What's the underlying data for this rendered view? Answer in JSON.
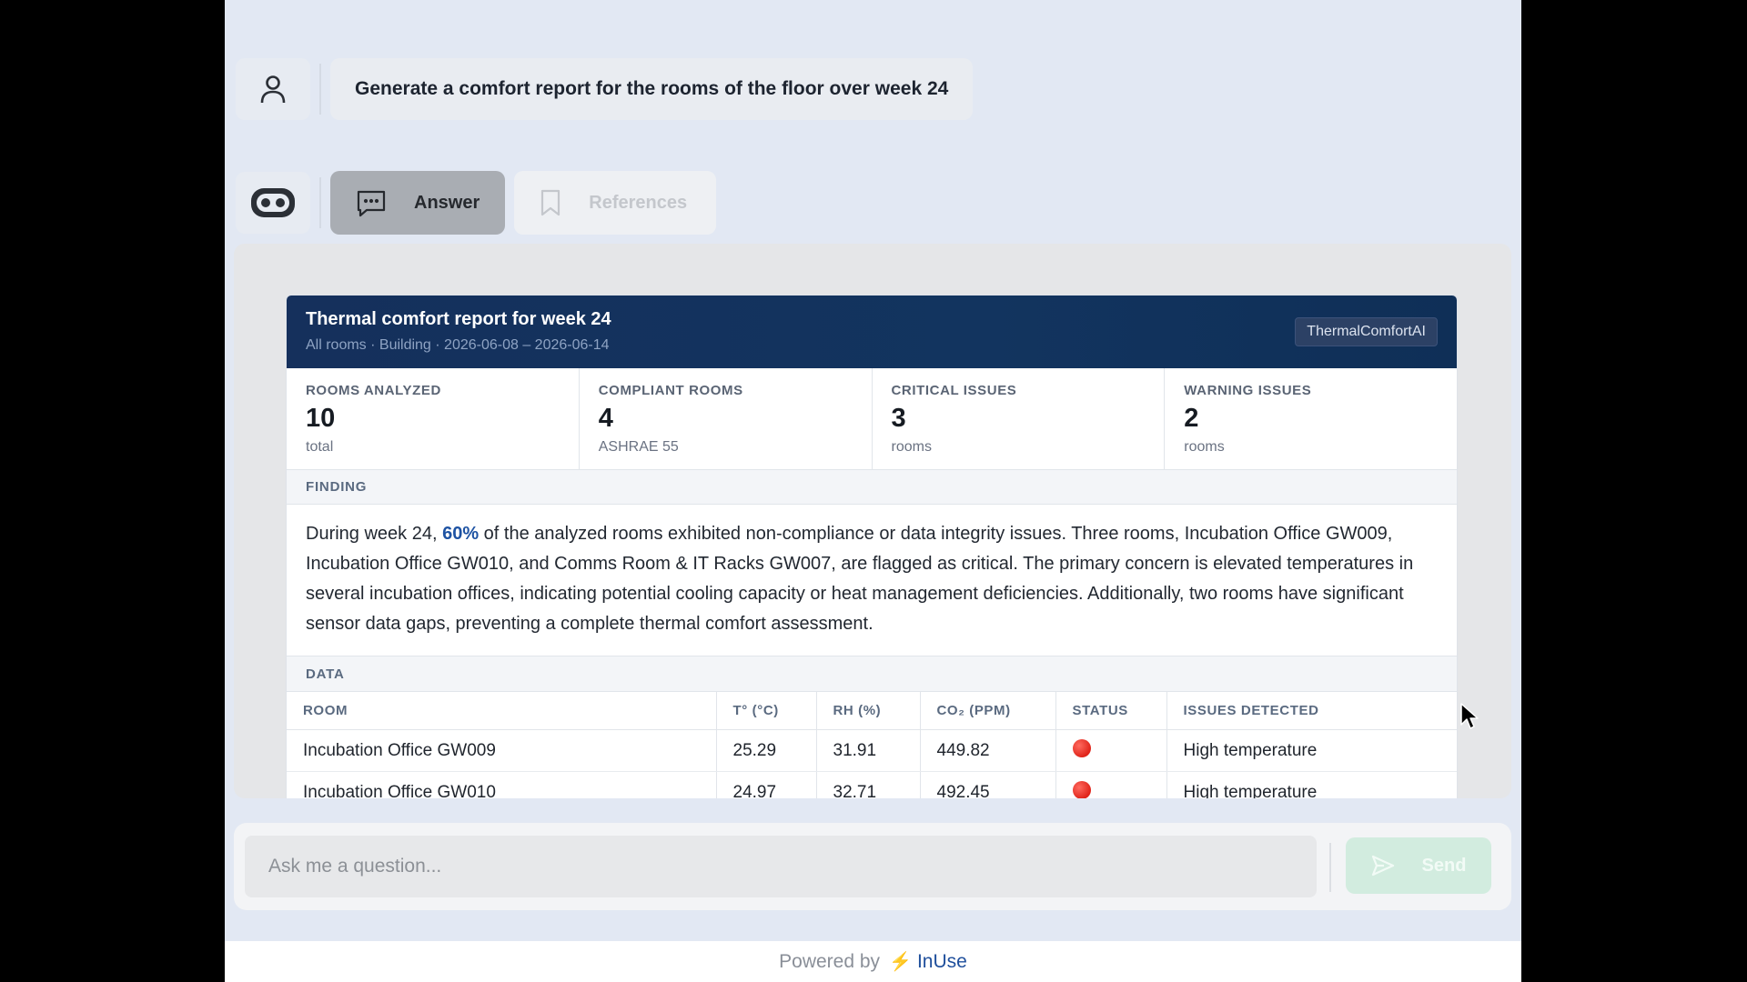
{
  "user_message": "Generate a comfort report for the rooms of the floor over week 24",
  "tabs": {
    "answer": "Answer",
    "references": "References"
  },
  "report": {
    "title": "Thermal comfort report for week 24",
    "subtitle": "All rooms · Building · 2026-06-08 – 2026-06-14",
    "badge": "ThermalComfortAI",
    "stats": [
      {
        "label": "ROOMS ANALYZED",
        "value": "10",
        "unit": "total"
      },
      {
        "label": "COMPLIANT ROOMS",
        "value": "4",
        "unit": "ASHRAE 55"
      },
      {
        "label": "CRITICAL ISSUES",
        "value": "3",
        "unit": "rooms"
      },
      {
        "label": "WARNING ISSUES",
        "value": "2",
        "unit": "rooms"
      }
    ],
    "finding_heading": "FINDING",
    "finding": {
      "prefix": "During week 24, ",
      "highlight": "60%",
      "suffix": " of the analyzed rooms exhibited non-compliance or data integrity issues. Three rooms, Incubation Office GW009, Incubation Office GW010, and Comms Room & IT Racks GW007, are flagged as critical. The primary concern is elevated temperatures in several incubation offices, indicating potential cooling capacity or heat management deficiencies. Additionally, two rooms have significant sensor data gaps, preventing a complete thermal comfort assessment."
    },
    "data_heading": "DATA",
    "columns": [
      "ROOM",
      "T° (°C)",
      "RH (%)",
      "CO₂ (PPM)",
      "STATUS",
      "ISSUES DETECTED"
    ],
    "rows": [
      {
        "room": "Incubation Office GW009",
        "temp": "25.29",
        "rh": "31.91",
        "co2": "449.82",
        "status_color": "#e0241a",
        "issues": "High temperature"
      },
      {
        "room": "Incubation Office GW010",
        "temp": "24.97",
        "rh": "32.71",
        "co2": "492.45",
        "status_color": "#e0241a",
        "issues": "High temperature"
      }
    ]
  },
  "input": {
    "placeholder": "Ask me a question...",
    "send_label": "Send"
  },
  "footer": {
    "powered_by": "Powered by",
    "brand": "InUse"
  }
}
